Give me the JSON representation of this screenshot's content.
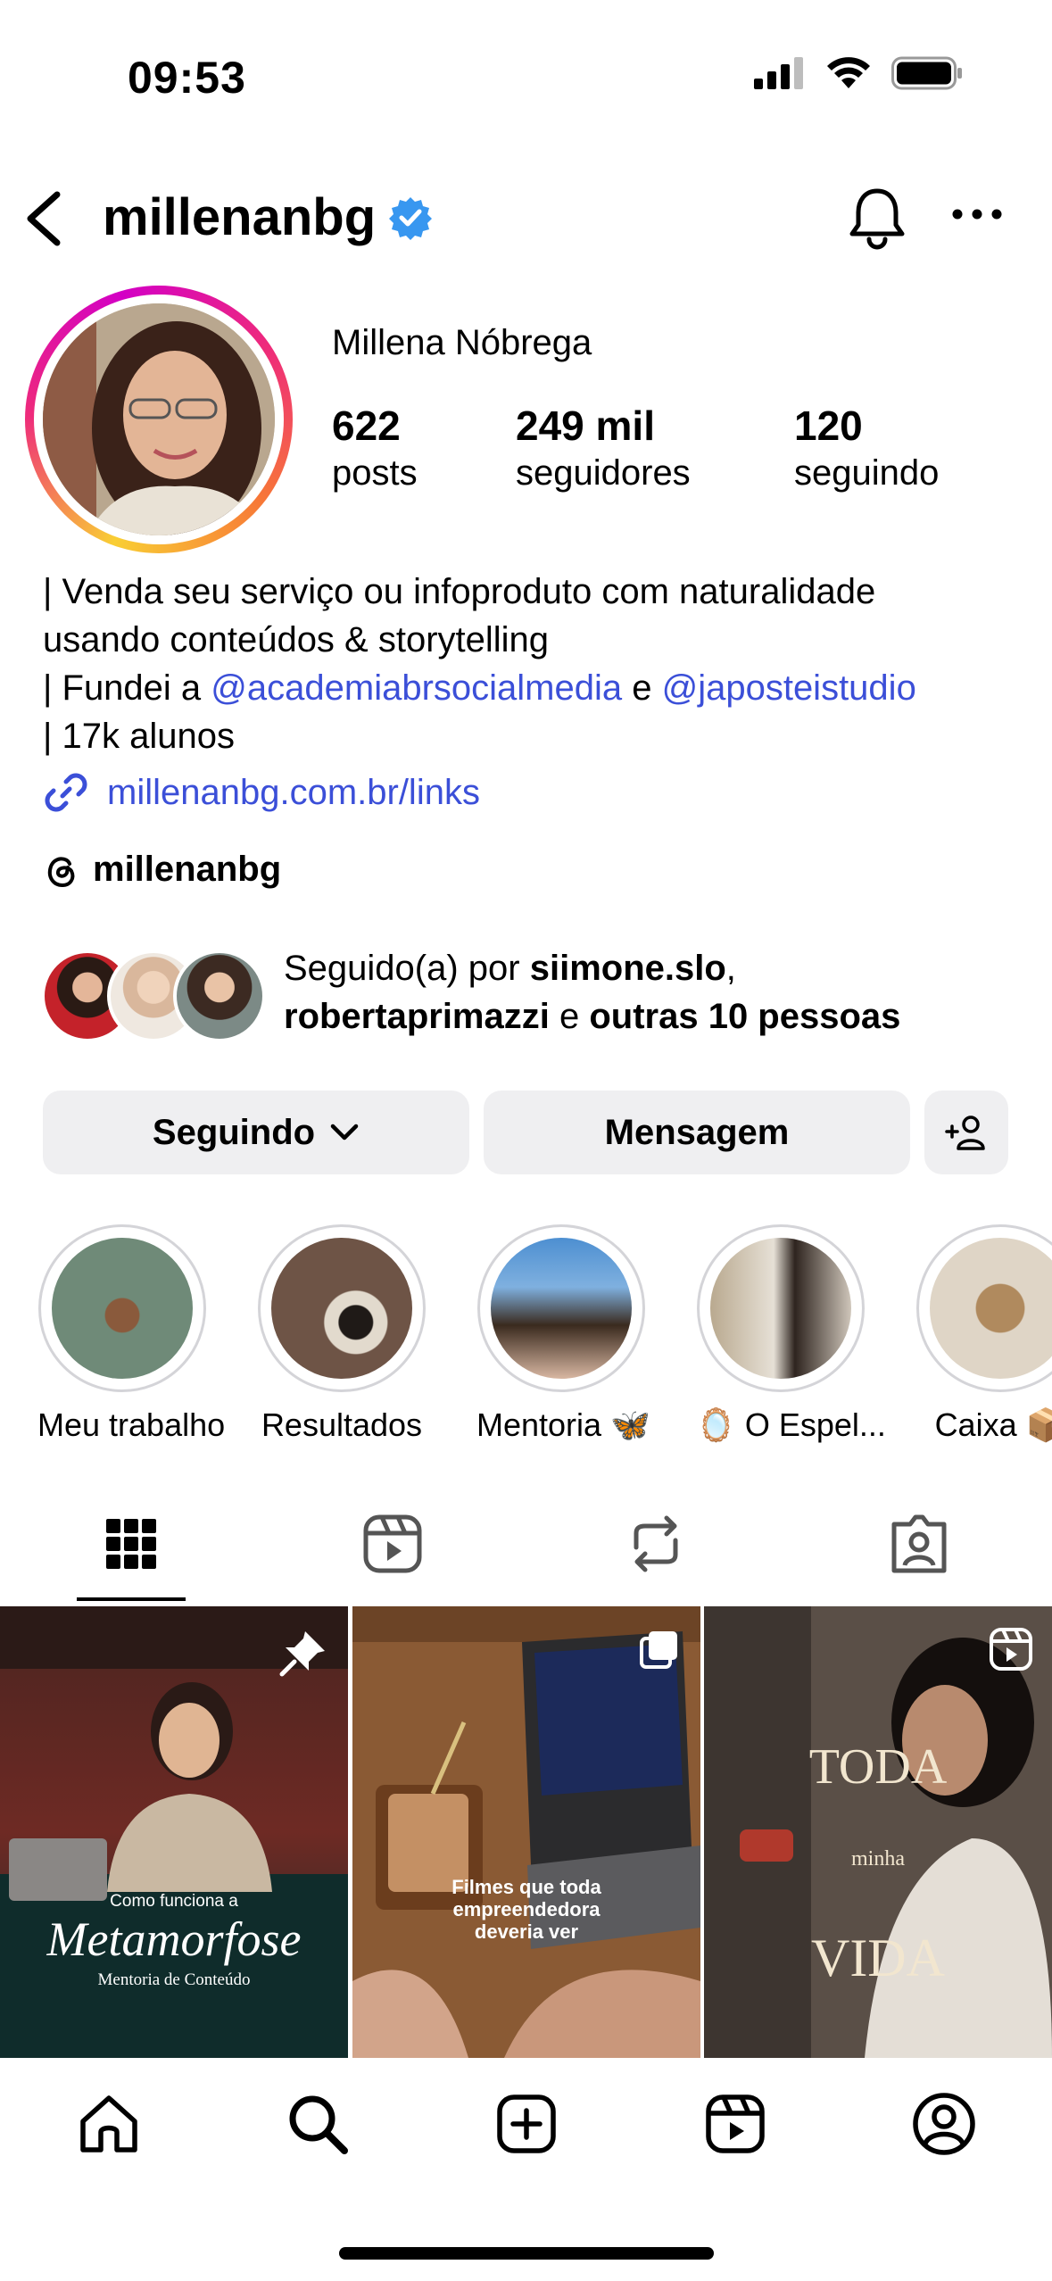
{
  "status_bar": {
    "time": "09:53"
  },
  "header": {
    "username": "millenanbg"
  },
  "profile": {
    "display_name": "Millena Nóbrega",
    "stats": [
      {
        "value": "622",
        "label": "posts"
      },
      {
        "value": "249 mil",
        "label": "seguidores"
      },
      {
        "value": "120",
        "label": "seguindo"
      }
    ],
    "bio": {
      "line1": "| Venda seu serviço ou infoproduto com naturalidade",
      "line2": "usando conteúdos & storytelling",
      "line3_prefix": "| Fundei a ",
      "mention1": "@academiabrsocialmedia",
      "line3_mid": " e ",
      "mention2": "@japosteistudio",
      "line4": "| 17k alunos"
    },
    "link": "millenanbg.com.br/links",
    "threads": "millenanbg",
    "followed_by": {
      "prefix": "Seguido(a) por ",
      "user1": "siimone.slo",
      "sep": ",",
      "user2": "robertaprimazzi",
      "mid": " e ",
      "others": "outras 10 pessoas"
    }
  },
  "buttons": {
    "following": "Seguindo",
    "message": "Mensagem"
  },
  "highlights": [
    {
      "label": "Meu trabalho"
    },
    {
      "label": "Resultados"
    },
    {
      "label": "Mentoria 🦋"
    },
    {
      "label": "🪞 O Espel..."
    },
    {
      "label": "Caixa 📦"
    }
  ],
  "posts": [
    {
      "line1": "Como funciona a",
      "line2": "Metamorfose",
      "line3": "Mentoria de Conteúdo"
    },
    {
      "line1": "Filmes que toda",
      "line2": "empreendedora",
      "line3": "deveria ver"
    },
    {
      "line1": "TODA",
      "line2": "minha",
      "line3": "VIDA"
    }
  ],
  "colors": {
    "link_blue": "#3b4fd8",
    "verified_blue": "#3897f0",
    "button_bg": "#efeff1"
  }
}
